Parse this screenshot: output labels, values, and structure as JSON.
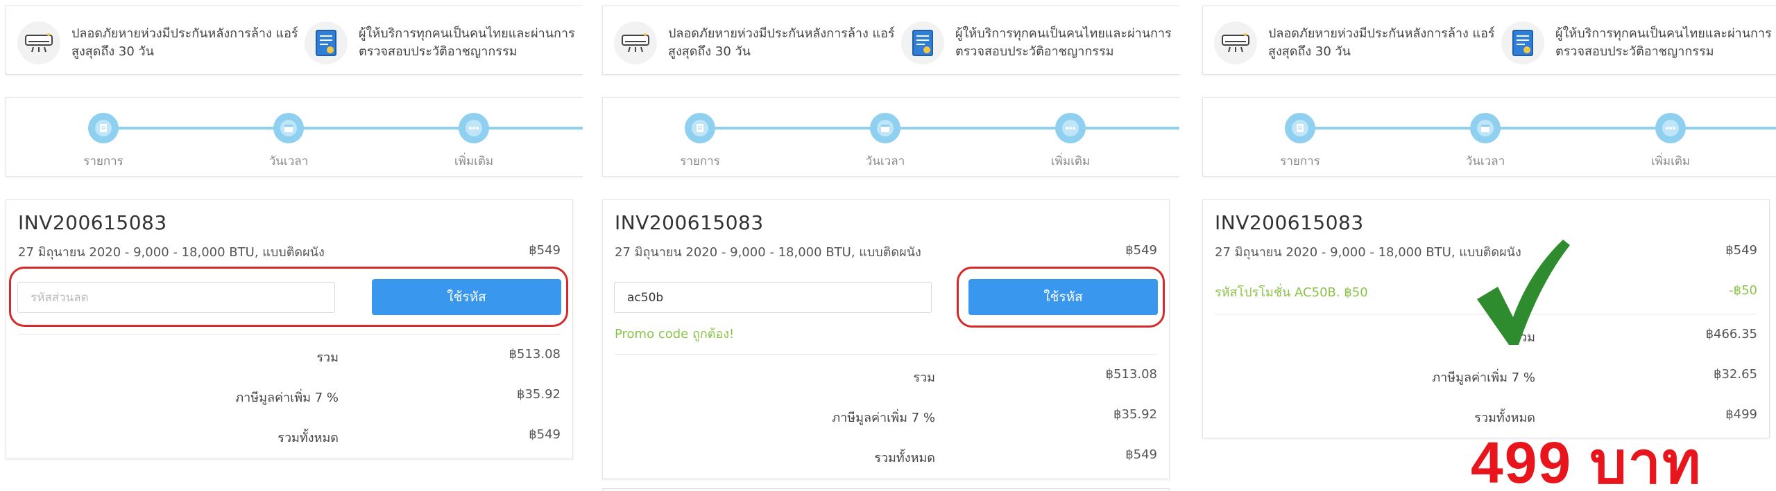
{
  "features": [
    {
      "icon": "air-conditioner-icon",
      "text": "ปลอดภัยหายห่วงมีประกันหลังการล้าง แอร์สูงสุดถึง 30 วัน"
    },
    {
      "icon": "certificate-document-icon",
      "text": "ผู้ให้บริการทุกคนเป็นคนไทยและผ่านการ ตรวจสอบประวัติอาชญากรรม"
    }
  ],
  "steps": [
    {
      "label": "รายการ",
      "icon": "document-icon"
    },
    {
      "label": "วันเวลา",
      "icon": "calendar-icon"
    },
    {
      "label": "เพิ่มเติม",
      "icon": "more-dots-icon"
    }
  ],
  "panels": [
    {
      "invoice": "INV200615083",
      "description": "27 มิถุนายน 2020 - 9,000 - 18,000 BTU, แบบติดผนัง",
      "price": "฿549",
      "promo_input_value": "",
      "promo_placeholder": "รหัสส่วนลด",
      "apply_label": "ใช้รหัส",
      "summary": [
        {
          "label": "รวม",
          "value": "฿513.08"
        },
        {
          "label": "ภาษีมูลค่าเพิ่ม 7 %",
          "value": "฿35.92"
        },
        {
          "label": "รวมทั้งหมด",
          "value": "฿549"
        }
      ]
    },
    {
      "invoice": "INV200615083",
      "description": "27 มิถุนายน 2020 - 9,000 - 18,000 BTU, แบบติดผนัง",
      "price": "฿549",
      "promo_input_value": "ac50b",
      "promo_placeholder": "รหัสส่วนลด",
      "apply_label": "ใช้รหัส",
      "promo_message": "Promo code ถูกต้อง!",
      "summary": [
        {
          "label": "รวม",
          "value": "฿513.08"
        },
        {
          "label": "ภาษีมูลค่าเพิ่ม 7 %",
          "value": "฿35.92"
        },
        {
          "label": "รวมทั้งหมด",
          "value": "฿549"
        }
      ]
    },
    {
      "invoice": "INV200615083",
      "description": "27 มิถุนายน 2020 - 9,000 - 18,000 BTU, แบบติดผนัง",
      "price": "฿549",
      "promo_applied_label": "รหัสโปรโมชั่น AC50B. ฿50",
      "promo_applied_value": "-฿50",
      "summary": [
        {
          "label": "รวม",
          "value": "฿466.35"
        },
        {
          "label": "ภาษีมูลค่าเพิ่ม 7 %",
          "value": "฿32.65"
        },
        {
          "label": "รวมทั้งหมด",
          "value": "฿499"
        }
      ],
      "overlay_price": "499 บาท"
    }
  ],
  "colors": {
    "accent_blue": "#3a97ee",
    "step_blue": "#8fd0f0",
    "promo_green": "#8bc34a",
    "highlight_red": "#d42a2a",
    "check_green": "#2e8b2e",
    "overlay_red": "#e8161c"
  }
}
